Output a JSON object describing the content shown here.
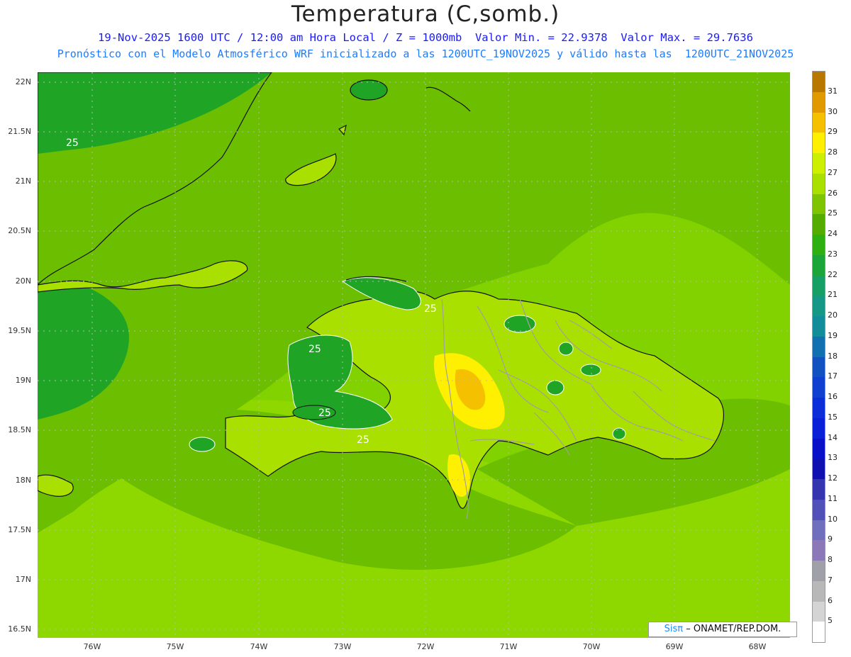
{
  "title": "Temperatura (C,somb.)",
  "subtitle_line1": "19-Nov-2025 1600 UTC / 12:00 am Hora Local / Z = 1000mb  Valor Min. = 22.9378  Valor Max. = 29.7636",
  "subtitle_line2": "Pronóstico con el Modelo Atmosférico WRF inicializado a las 1200UTC_19NOV2025 y válido hasta las  1200UTC_21NOV2025",
  "axes": {
    "lat_labels": [
      "22N",
      "21.5N",
      "21N",
      "20.5N",
      "20N",
      "19.5N",
      "19N",
      "18.5N",
      "18N",
      "17.5N",
      "17N",
      "16.5N"
    ],
    "lon_labels": [
      "76W",
      "75W",
      "74W",
      "73W",
      "72W",
      "71W",
      "70W",
      "69W",
      "68W"
    ]
  },
  "contour_labels": [
    "25",
    "25",
    "25",
    "25",
    "25"
  ],
  "colorbar": {
    "labels": [
      "31",
      "30",
      "29",
      "28",
      "27",
      "26",
      "25",
      "24",
      "23",
      "22",
      "21",
      "20",
      "19",
      "18",
      "17",
      "16",
      "15",
      "14",
      "13",
      "12",
      "11",
      "10",
      "9",
      "8",
      "7",
      "6",
      "5"
    ],
    "colors": [
      "#b87800",
      "#e09a00",
      "#f5c000",
      "#ffef00",
      "#cdf000",
      "#a9e000",
      "#7fc400",
      "#55ac00",
      "#2fb012",
      "#1ca63a",
      "#17a065",
      "#159885",
      "#138d9a",
      "#1370b0",
      "#1252c0",
      "#1040d0",
      "#0b2ed8",
      "#0a1fd8",
      "#0a10c8",
      "#1010b0",
      "#3535b0",
      "#5050b8",
      "#6f6fbe",
      "#8a78b8",
      "#a0a0a8",
      "#b8b8b8",
      "#d4d4d4",
      "#ffffff"
    ]
  },
  "credit": {
    "brand": "Sisπ",
    "separator": "–",
    "org": "ONAMET/REP.DOM."
  },
  "legend_colors": {
    "background_field": "#82d200",
    "warm_core": "#f5e600"
  }
}
